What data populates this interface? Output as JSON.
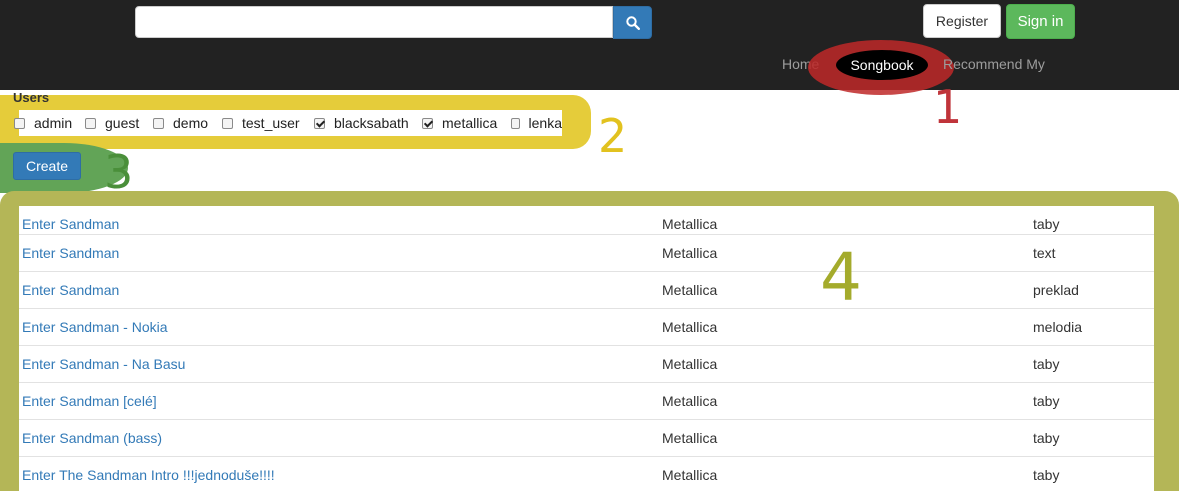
{
  "navbar": {
    "search": {
      "value": "",
      "placeholder": ""
    },
    "search_icon": "search-icon",
    "register_label": "Register",
    "signin_label": "Sign in",
    "nav_links": [
      "Home",
      "Songbook",
      "Recommend My"
    ]
  },
  "annotations": {
    "one": "1",
    "two": "2",
    "three": "3",
    "four": "4"
  },
  "users": {
    "label": "Users",
    "options": [
      {
        "name": "admin",
        "checked": false
      },
      {
        "name": "guest",
        "checked": false
      },
      {
        "name": "demo",
        "checked": false
      },
      {
        "name": "test_user",
        "checked": false
      },
      {
        "name": "blacksabath",
        "checked": true
      },
      {
        "name": "metallica",
        "checked": true
      },
      {
        "name": "lenka",
        "checked": false
      }
    ]
  },
  "create_label": "Create",
  "results": [
    {
      "title": "Enter Sandman",
      "artist": "Metallica",
      "type": "taby"
    },
    {
      "title": "Enter Sandman",
      "artist": "Metallica",
      "type": "text"
    },
    {
      "title": "Enter Sandman",
      "artist": "Metallica",
      "type": "preklad"
    },
    {
      "title": "Enter Sandman - Nokia",
      "artist": "Metallica",
      "type": "melodia"
    },
    {
      "title": "Enter Sandman - Na Basu",
      "artist": "Metallica",
      "type": "taby"
    },
    {
      "title": "Enter Sandman [celé]",
      "artist": "Metallica",
      "type": "taby"
    },
    {
      "title": "Enter Sandman (bass)",
      "artist": "Metallica",
      "type": "taby"
    },
    {
      "title": "Enter The Sandman Intro !!!jednoduše!!!!",
      "artist": "Metallica",
      "type": "taby"
    }
  ],
  "colors": {
    "navbar": "#222222",
    "primary": "#337ab7",
    "success": "#5cb85c",
    "annotation_1": "#c0343a",
    "annotation_2": "#e2c21f",
    "annotation_3": "#4a8f3a",
    "annotation_4": "#a4ab2c"
  }
}
